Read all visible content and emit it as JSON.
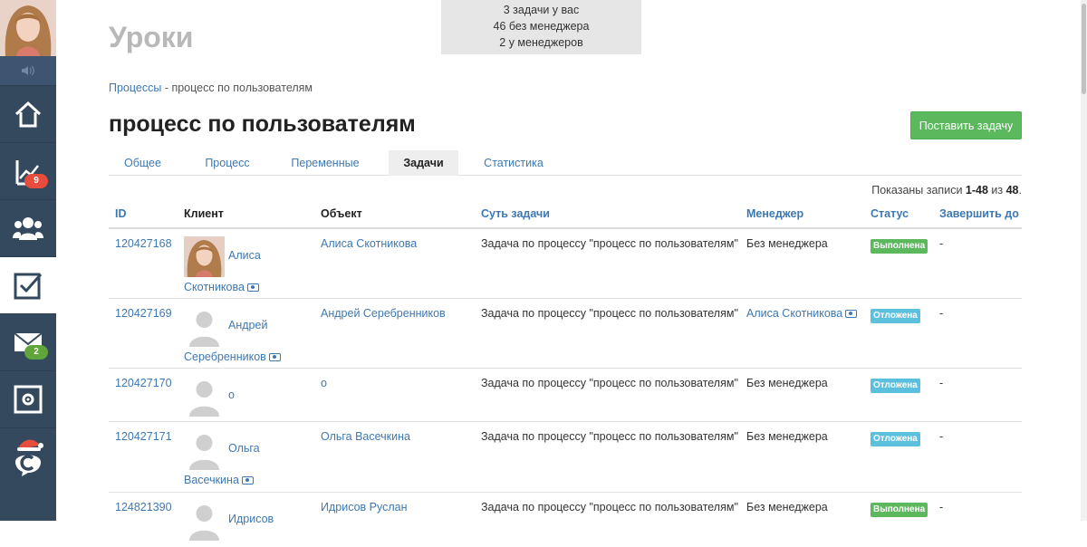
{
  "sidebar": {
    "items": [
      {
        "name": "home",
        "icon": "home-icon",
        "badge": ""
      },
      {
        "name": "analytics",
        "icon": "chart-icon",
        "badge": "9",
        "badge_color": "#e74c3c"
      },
      {
        "name": "users",
        "icon": "users-icon",
        "badge": ""
      },
      {
        "name": "tasks",
        "icon": "checkbox-icon",
        "badge": "",
        "active": true
      },
      {
        "name": "mail",
        "icon": "mail-icon",
        "badge": "2",
        "badge_color": "#5fa53a"
      },
      {
        "name": "settings",
        "icon": "safe-gear-icon",
        "badge": ""
      },
      {
        "name": "chat",
        "icon": "santa-chat-icon",
        "badge": ""
      }
    ]
  },
  "infobox": {
    "line1": "3 задачи у вас",
    "line2": "46 без менеджера",
    "line3": "2 у менеджеров"
  },
  "page_header": "Уроки",
  "breadcrumb": {
    "link": "Процессы",
    "separator": " - ",
    "current": "процесс по пользователям"
  },
  "title": "процесс по пользователям",
  "add_task_button": "Поставить задачу",
  "tabs": [
    "Общее",
    "Процесс",
    "Переменные",
    "Задачи",
    "Статистика"
  ],
  "active_tab": "Задачи",
  "records": {
    "prefix": "Показаны записи ",
    "range": "1-48",
    "middle": " из ",
    "total": "48",
    "suffix": "."
  },
  "table": {
    "headers": {
      "id": "ID",
      "client": "Клиент",
      "object": "Объект",
      "summary": "Суть задачи",
      "manager": "Менеджер",
      "status": "Статус",
      "due": "Завершить до"
    },
    "rows": [
      {
        "id": "120427168",
        "client_first": "Алиса",
        "client_last": "Скотникова",
        "avatar": "photo",
        "object": "Алиса Скотникова",
        "summary": "Задача по процессу \"процесс по пользователям\"",
        "manager": "Без менеджера",
        "manager_link": false,
        "status": "Выполнена",
        "status_type": "done",
        "due": "-"
      },
      {
        "id": "120427169",
        "client_first": "Андрей",
        "client_last": "Серебренников",
        "avatar": "default",
        "object": "Андрей Серебренников",
        "summary": "Задача по процессу \"процесс по пользователям\"",
        "manager": "Алиса Скотникова",
        "manager_link": true,
        "status": "Отложена",
        "status_type": "postponed",
        "due": "-"
      },
      {
        "id": "120427170",
        "client_first": "о",
        "client_last": "",
        "avatar": "default",
        "object": "о",
        "summary": "Задача по процессу \"процесс по пользователям\"",
        "manager": "Без менеджера",
        "manager_link": false,
        "status": "Отложена",
        "status_type": "postponed",
        "due": "-"
      },
      {
        "id": "120427171",
        "client_first": "Ольга",
        "client_last": "Васечкина",
        "avatar": "default",
        "object": "Ольга Васечкина",
        "summary": "Задача по процессу \"процесс по пользователям\"",
        "manager": "Без менеджера",
        "manager_link": false,
        "status": "Отложена",
        "status_type": "postponed",
        "due": "-"
      },
      {
        "id": "124821390",
        "client_first": "Идрисов",
        "client_last": "",
        "avatar": "default",
        "object": "Идрисов Руслан",
        "summary": "Задача по процессу \"процесс по пользователям\"",
        "manager": "Без менеджера",
        "manager_link": false,
        "status": "Выполнена",
        "status_type": "done",
        "due": "-"
      }
    ]
  }
}
